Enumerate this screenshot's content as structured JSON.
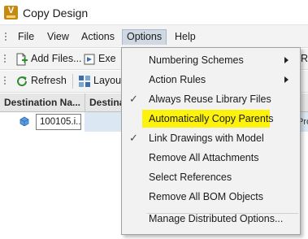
{
  "window": {
    "title": "Copy Design",
    "logo_letter": "V"
  },
  "menubar": {
    "items": [
      "File",
      "View",
      "Actions",
      "Options",
      "Help"
    ],
    "active": "Options"
  },
  "toolbar1": {
    "add_files": "Add Files...",
    "execute_partial": "Exe",
    "right_partial": "R"
  },
  "toolbar2": {
    "refresh": "Refresh",
    "layout_partial": "Layou"
  },
  "grid": {
    "columns": [
      "Destination Na...",
      "Destinati"
    ],
    "rows": [
      {
        "name": "100105.i...",
        "right_text": "Pro"
      }
    ]
  },
  "options_menu": {
    "items": [
      {
        "label": "Numbering Schemes",
        "checked": false,
        "submenu": true
      },
      {
        "label": "Action Rules",
        "checked": false,
        "submenu": true
      },
      {
        "label": "Always Reuse Library Files",
        "checked": true,
        "submenu": false
      },
      {
        "label": "Automatically Copy Parents",
        "checked": false,
        "submenu": false,
        "highlighted": true
      },
      {
        "label": "Link Drawings with Model",
        "checked": true,
        "submenu": false
      },
      {
        "label": "Remove All Attachments",
        "checked": false,
        "submenu": false
      },
      {
        "label": "Select References",
        "checked": false,
        "submenu": false
      },
      {
        "label": "Remove All BOM Objects",
        "checked": false,
        "submenu": false
      },
      {
        "label": "Manage Distributed Options...",
        "checked": false,
        "submenu": false
      }
    ],
    "check_glyph": "✓",
    "highlight_color": "#fcf20c"
  },
  "icons": {
    "app": "vault-logo-icon",
    "add_files": "add-files-icon",
    "execute": "execute-icon",
    "refresh": "refresh-icon",
    "layout": "layout-icon",
    "file": "part-file-icon",
    "grip": "grip-icon",
    "submenu": "submenu-arrow-icon",
    "check": "checkmark-icon"
  }
}
